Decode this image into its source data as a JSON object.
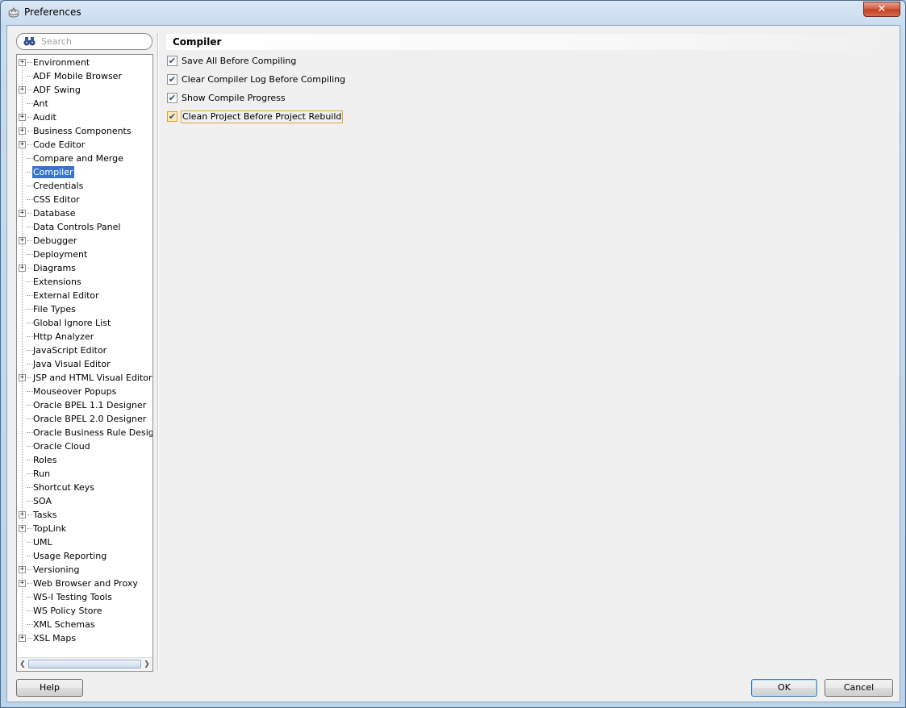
{
  "window": {
    "title": "Preferences",
    "close_glyph": "✕"
  },
  "search": {
    "placeholder": "Search",
    "value": ""
  },
  "tree": {
    "selected": "Compiler",
    "items": [
      {
        "label": "Environment",
        "expandable": true
      },
      {
        "label": "ADF Mobile Browser",
        "expandable": false
      },
      {
        "label": "ADF Swing",
        "expandable": true
      },
      {
        "label": "Ant",
        "expandable": false
      },
      {
        "label": "Audit",
        "expandable": true
      },
      {
        "label": "Business Components",
        "expandable": true
      },
      {
        "label": "Code Editor",
        "expandable": true
      },
      {
        "label": "Compare and Merge",
        "expandable": false
      },
      {
        "label": "Compiler",
        "expandable": false
      },
      {
        "label": "Credentials",
        "expandable": false
      },
      {
        "label": "CSS Editor",
        "expandable": false
      },
      {
        "label": "Database",
        "expandable": true
      },
      {
        "label": "Data Controls Panel",
        "expandable": false
      },
      {
        "label": "Debugger",
        "expandable": true
      },
      {
        "label": "Deployment",
        "expandable": false
      },
      {
        "label": "Diagrams",
        "expandable": true
      },
      {
        "label": "Extensions",
        "expandable": false
      },
      {
        "label": "External Editor",
        "expandable": false
      },
      {
        "label": "File Types",
        "expandable": false
      },
      {
        "label": "Global Ignore List",
        "expandable": false
      },
      {
        "label": "Http Analyzer",
        "expandable": false
      },
      {
        "label": "JavaScript Editor",
        "expandable": false
      },
      {
        "label": "Java Visual Editor",
        "expandable": false
      },
      {
        "label": "JSP and HTML Visual Editor",
        "expandable": true
      },
      {
        "label": "Mouseover Popups",
        "expandable": false
      },
      {
        "label": "Oracle BPEL 1.1 Designer",
        "expandable": false
      },
      {
        "label": "Oracle BPEL 2.0 Designer",
        "expandable": false
      },
      {
        "label": "Oracle Business Rule Designer",
        "expandable": false
      },
      {
        "label": "Oracle Cloud",
        "expandable": false
      },
      {
        "label": "Roles",
        "expandable": false
      },
      {
        "label": "Run",
        "expandable": false
      },
      {
        "label": "Shortcut Keys",
        "expandable": false
      },
      {
        "label": "SOA",
        "expandable": false
      },
      {
        "label": "Tasks",
        "expandable": true
      },
      {
        "label": "TopLink",
        "expandable": true
      },
      {
        "label": "UML",
        "expandable": false
      },
      {
        "label": "Usage Reporting",
        "expandable": false
      },
      {
        "label": "Versioning",
        "expandable": true
      },
      {
        "label": "Web Browser and Proxy",
        "expandable": true
      },
      {
        "label": "WS-I Testing Tools",
        "expandable": false
      },
      {
        "label": "WS Policy Store",
        "expandable": false
      },
      {
        "label": "XML Schemas",
        "expandable": false
      },
      {
        "label": "XSL Maps",
        "expandable": true
      }
    ]
  },
  "compiler": {
    "header": "Compiler",
    "options": [
      {
        "label": "Save All Before Compiling",
        "checked": true
      },
      {
        "label": "Clear Compiler Log Before Compiling",
        "checked": true
      },
      {
        "label": "Show Compile Progress",
        "checked": true
      },
      {
        "label": "Clean Project Before Project Rebuild",
        "checked": true
      }
    ]
  },
  "buttons": {
    "help": "Help",
    "ok": "OK",
    "cancel": "Cancel"
  },
  "glyphs": {
    "check": "✔",
    "plus": "+",
    "left": "❮",
    "right": "❯"
  }
}
